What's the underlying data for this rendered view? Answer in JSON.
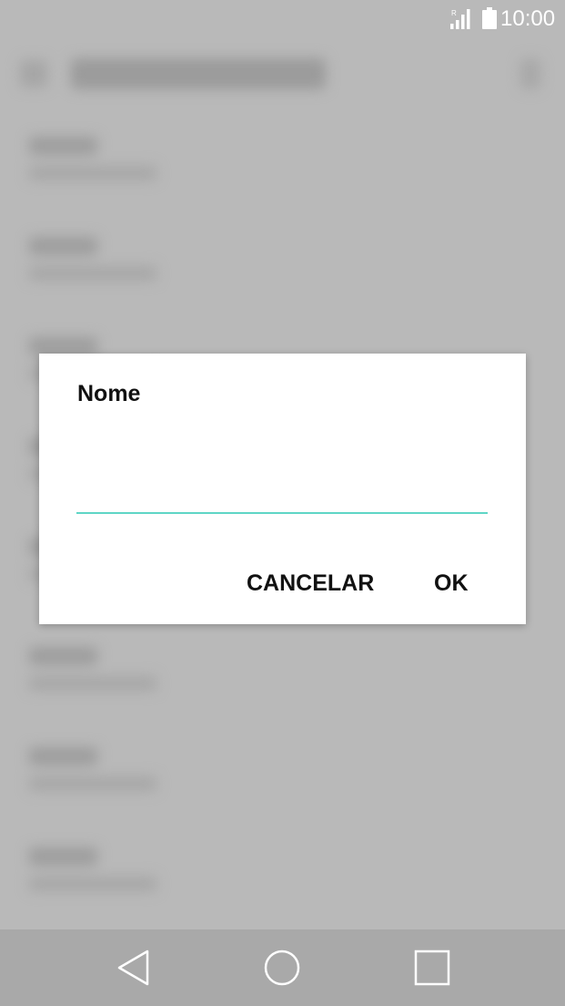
{
  "status_bar": {
    "signal_indicator": "R",
    "time": "10:00",
    "icons": [
      "signal-icon",
      "battery-icon"
    ]
  },
  "dialog": {
    "title": "Nome",
    "input": {
      "value": "",
      "placeholder": ""
    },
    "cancel_label": "CANCELAR",
    "ok_label": "OK",
    "accent_color": "#5fd6c6"
  },
  "nav_bar": {
    "icons": [
      "back-icon",
      "home-icon",
      "recent-apps-icon"
    ]
  }
}
